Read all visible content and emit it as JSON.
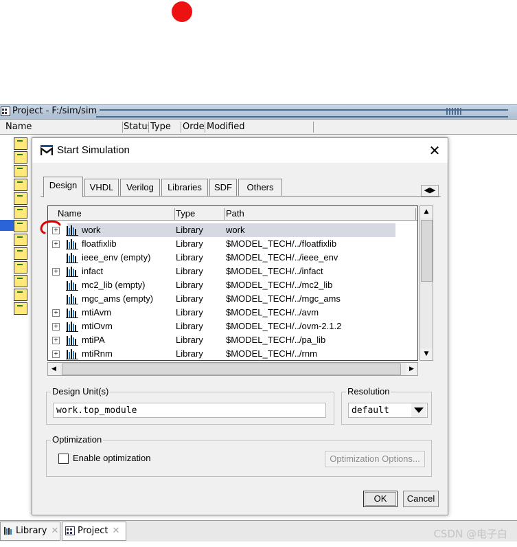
{
  "project_window": {
    "title": "Project - F:/sim/sim",
    "columns": [
      "Name",
      "Status",
      "Type",
      "Order",
      "Modified"
    ],
    "column_display": [
      "Name",
      "Status",
      "Type",
      "Orde",
      "Modified"
    ]
  },
  "bottom_tabs": [
    {
      "label": "Library",
      "icon": "library-icon"
    },
    {
      "label": "Project",
      "icon": "project-icon"
    }
  ],
  "watermark": "CSDN @电子白",
  "dialog": {
    "title": "Start Simulation",
    "close_symbol": "✕",
    "tabs": [
      "Design",
      "VHDL",
      "Verilog",
      "Libraries",
      "SDF",
      "Others"
    ],
    "active_tab": "Design",
    "tab_scroll": "◀▶",
    "library_columns": {
      "name": "Name",
      "type": "Type",
      "path": "Path"
    },
    "libraries": [
      {
        "name": "work",
        "type": "Library",
        "path": "work",
        "expander": "+",
        "selected": true
      },
      {
        "name": "floatfixlib",
        "type": "Library",
        "path": "$MODEL_TECH/../floatfixlib",
        "expander": "+"
      },
      {
        "name": "ieee_env  (empty)",
        "type": "Library",
        "path": "$MODEL_TECH/../ieee_env",
        "expander": ""
      },
      {
        "name": "infact",
        "type": "Library",
        "path": "$MODEL_TECH/../infact",
        "expander": "+"
      },
      {
        "name": "mc2_lib  (empty)",
        "type": "Library",
        "path": "$MODEL_TECH/../mc2_lib",
        "expander": ""
      },
      {
        "name": "mgc_ams  (empty)",
        "type": "Library",
        "path": "$MODEL_TECH/../mgc_ams",
        "expander": ""
      },
      {
        "name": "mtiAvm",
        "type": "Library",
        "path": "$MODEL_TECH/../avm",
        "expander": "+"
      },
      {
        "name": "mtiOvm",
        "type": "Library",
        "path": "$MODEL_TECH/../ovm-2.1.2",
        "expander": "+"
      },
      {
        "name": "mtiPA",
        "type": "Library",
        "path": "$MODEL_TECH/../pa_lib",
        "expander": "+"
      },
      {
        "name": "mtiRnm",
        "type": "Library",
        "path": "$MODEL_TECH/../rnm",
        "expander": "+"
      }
    ],
    "design_unit": {
      "label": "Design Unit(s)",
      "value": "work.top_module"
    },
    "resolution": {
      "label": "Resolution",
      "value": "default"
    },
    "optimization": {
      "label": "Optimization",
      "checkbox_label": "Enable optimization",
      "checked": false,
      "options_button": "Optimization Options..."
    },
    "ok_label": "OK",
    "cancel_label": "Cancel"
  },
  "colors": {
    "red_dot": "#ee1111",
    "selection": "#d6d9e1",
    "highlight_blue": "#2b64d8"
  }
}
